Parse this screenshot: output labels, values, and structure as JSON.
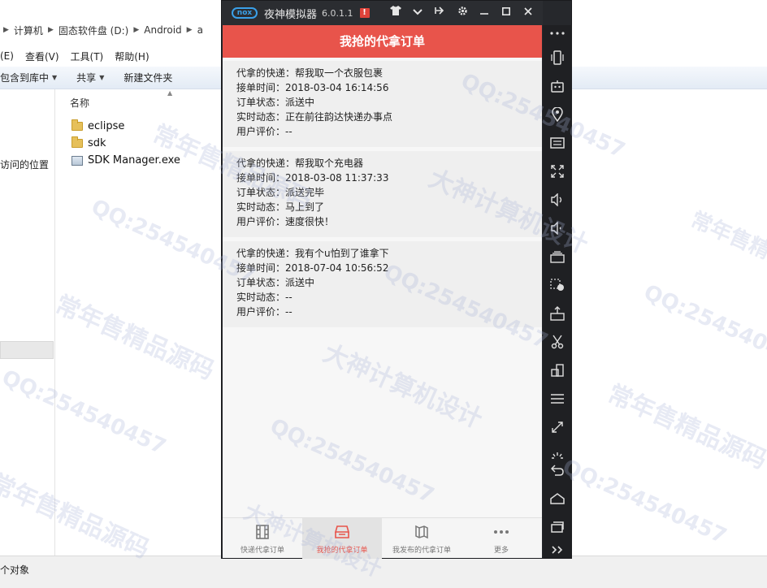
{
  "explorer": {
    "breadcrumb": [
      "计算机",
      "固态软件盘 (D:)",
      "Android",
      "a"
    ],
    "menu": [
      "(E)",
      "查看(V)",
      "工具(T)",
      "帮助(H)"
    ],
    "toolbar": {
      "include_library": "包含到库中",
      "share": "共享",
      "new_folder": "新建文件夹"
    },
    "nav": {
      "location_label": "访问的位置"
    },
    "column_name": "名称",
    "files": [
      {
        "name": "eclipse",
        "type": "folder"
      },
      {
        "name": "sdk",
        "type": "folder"
      },
      {
        "name": "SDK Manager.exe",
        "type": "exe"
      }
    ],
    "status": "个对象"
  },
  "emulator": {
    "logo": "nox",
    "title": "夜神模拟器",
    "version": "6.0.1.1",
    "alert": "!"
  },
  "app": {
    "header_title": "我抢的代拿订单",
    "orders": [
      {
        "item": "代拿的快递：帮我取一个衣服包裹",
        "time": "接单时间：2018-03-04 16:14:56",
        "status": "订单状态：派送中",
        "dynamic": "实时动态：正在前往韵达快递办事点",
        "review": "用户评价：--"
      },
      {
        "item": "代拿的快递：帮我取个充电器",
        "time": "接单时间：2018-03-08 11:37:33",
        "status": "订单状态：派送完毕",
        "dynamic": "实时动态：马上到了",
        "review": "用户评价：速度很快！"
      },
      {
        "item": "代拿的快递：我有个u怕到了谁拿下",
        "time": "接单时间：2018-07-04 10:56:52",
        "status": "订单状态：派送中",
        "dynamic": "实时动态：--",
        "review": "用户评价：--"
      }
    ],
    "bottom_nav": [
      {
        "label": "快递代拿订单",
        "icon": "film-icon",
        "active": false
      },
      {
        "label": "我抢的代拿订单",
        "icon": "tray-icon",
        "active": true
      },
      {
        "label": "我发布的代拿订单",
        "icon": "map-icon",
        "active": false
      },
      {
        "label": "更多",
        "icon": "more-icon",
        "active": false
      }
    ]
  },
  "colors": {
    "accent": "#e8544b",
    "nox_frame": "#26282c",
    "nox_blue": "#3aa0e8"
  },
  "watermarks": [
    "常年售精品源码",
    "QQ:254540457",
    "大神计算机设计"
  ]
}
